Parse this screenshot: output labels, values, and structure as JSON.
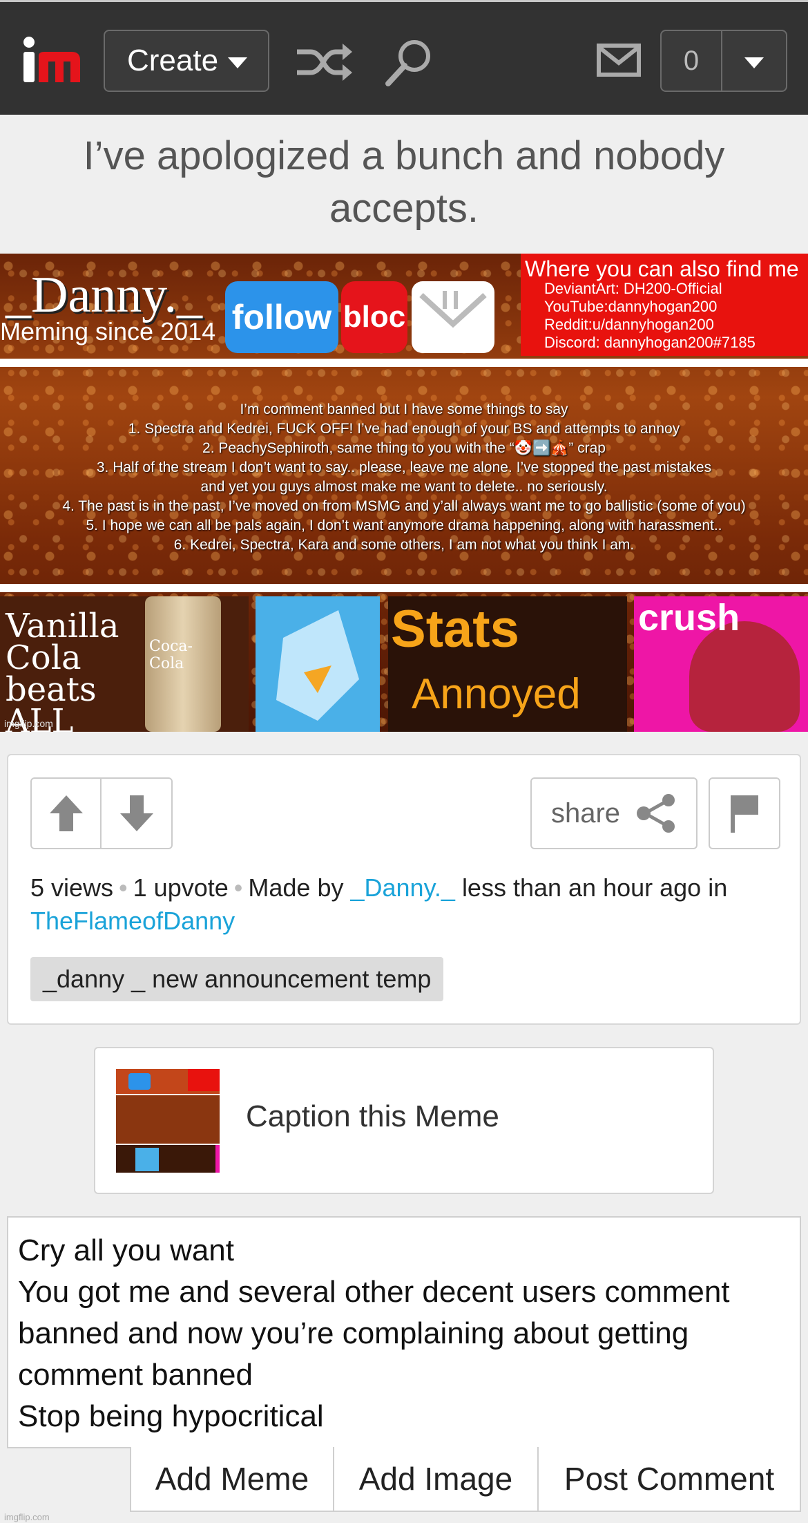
{
  "nav": {
    "logo_text": "im",
    "create_label": "Create",
    "notif_count": "0"
  },
  "meme": {
    "title": "I’ve apologized a bunch and nobody accepts.",
    "header_name": "_Danny._",
    "meming_since": "Meming since 2014",
    "follow_label": "follow",
    "block_label": "bloc",
    "find_me_title": "Where you can also find me",
    "find_me_lines": [
      "DeviantArt: DH200-Official",
      "YouTube:dannyhogan200",
      "Reddit:u/dannyhogan200",
      "Discord: dannyhogan200#7185"
    ],
    "announcement_lines": [
      "I’m comment banned but I have some things to say",
      "1. Spectra and Kedrei, FUCK OFF! I’ve had enough of your BS and attempts to annoy",
      "2. PeachySephiroth, same thing to you with the “🤡➡️🎪” crap",
      "3. Half of the stream I don’t want to say.. please, leave me alone. I’ve stopped the past mistakes",
      "and yet you guys almost make me want to delete.. no seriously.",
      "4. The past is in the past, I’ve moved on from MSMG and y’all always want me to go ballistic (some of you)",
      "5. I hope we can all be pals again, I don’t want anymore drama happening, along with harassment..",
      "6. Kedrei, Spectra, Kara and some others, I am not what you think I am."
    ],
    "vanilla_text": "Vanilla Cola beats ALL",
    "can_text": "Coca-Cola",
    "stats_title": "Stats",
    "stats_value": "Annoyed",
    "crush_title": "crush",
    "watermark": "imgflip.com"
  },
  "post": {
    "share_label": "share",
    "views": "5 views",
    "upvotes": "1 upvote",
    "made_by_prefix": "Made by",
    "author": "_Danny._",
    "time_ago": "less than an hour ago",
    "in_label": "in",
    "stream": "TheFlameofDanny",
    "tag": "_danny _ new announcement temp"
  },
  "caption": {
    "label": "Caption this Meme"
  },
  "comment": {
    "text": "Cry all you want\nYou got me and several other decent users comment banned and now you’re complaining about getting comment banned\nStop being hypocritical",
    "add_meme": "Add Meme",
    "add_image": "Add Image",
    "post_comment": "Post Comment"
  },
  "footer": {
    "watermark": "imgflip.com"
  },
  "colors": {
    "link": "#1aa3d9",
    "nav_bg": "#323232",
    "logo_red": "#e5141b"
  }
}
